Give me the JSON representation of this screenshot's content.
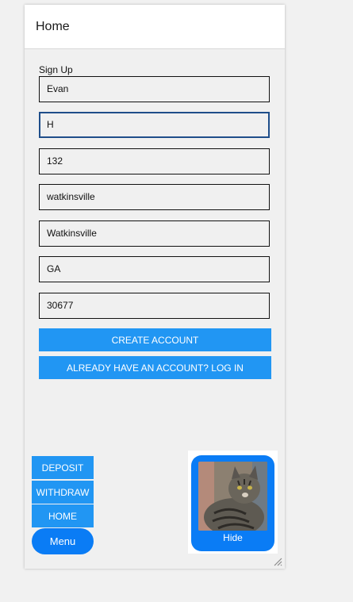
{
  "window": {
    "title": "Home"
  },
  "form": {
    "heading": "Sign Up",
    "fields": [
      {
        "value": "Evan"
      },
      {
        "value": "H"
      },
      {
        "value": "132"
      },
      {
        "value": "watkinsville"
      },
      {
        "value": "Watkinsville"
      },
      {
        "value": "GA"
      },
      {
        "value": "30677"
      }
    ],
    "create_account_label": "CREATE ACCOUNT",
    "login_label": "ALREADY HAVE AN ACCOUNT? LOG IN"
  },
  "nav": {
    "deposit_label": "DEPOSIT",
    "withdraw_label": "WITHDRAW",
    "home_label": "HOME",
    "menu_label": "Menu"
  },
  "cat_card": {
    "hide_label": "Hide"
  },
  "colors": {
    "primary": "#2196f3",
    "accent": "#0a7cf5"
  }
}
